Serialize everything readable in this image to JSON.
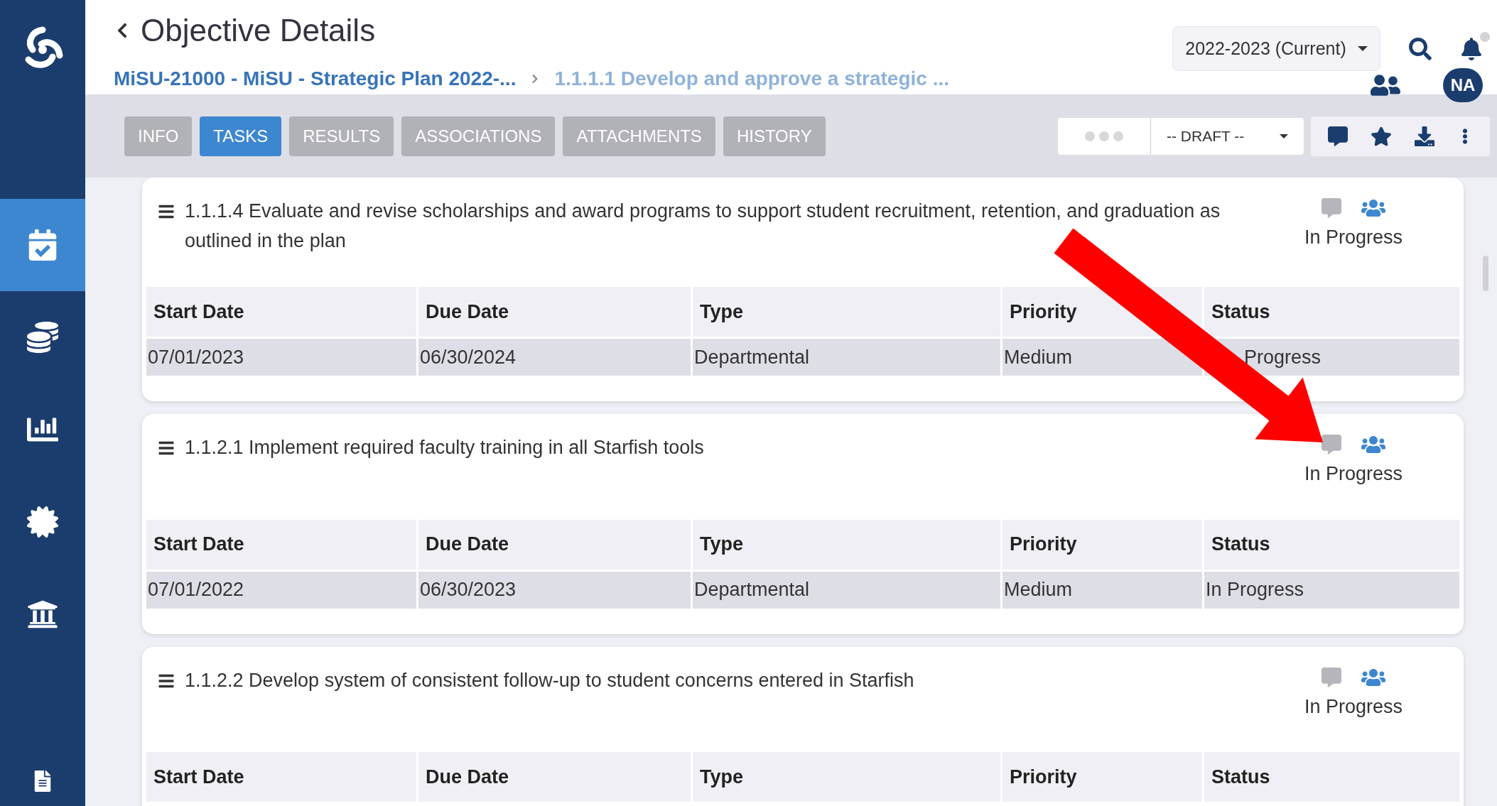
{
  "header": {
    "title": "Objective Details",
    "breadcrumbs": [
      "MiSU-21000 - MiSU - Strategic Plan 2022-...",
      "1.1.1.1 Develop and approve a strategic ..."
    ],
    "year": "2022-2023 (Current)",
    "avatar": "NA"
  },
  "sidebar": {
    "items": [
      {
        "kind": "calendar",
        "selected": true
      },
      {
        "kind": "coins",
        "selected": false
      },
      {
        "kind": "chart",
        "selected": false
      },
      {
        "kind": "badge",
        "selected": false
      },
      {
        "kind": "institution",
        "selected": false
      },
      {
        "kind": "file",
        "selected": false
      }
    ]
  },
  "tabs": [
    {
      "label": "INFO",
      "selected": false
    },
    {
      "label": "TASKS",
      "selected": true
    },
    {
      "label": "RESULTS",
      "selected": false
    },
    {
      "label": "ASSOCIATIONS",
      "selected": false
    },
    {
      "label": "ATTACHMENTS",
      "selected": false
    },
    {
      "label": "HISTORY",
      "selected": false
    }
  ],
  "stage_select": "-- DRAFT --",
  "tasks": [
    {
      "title": "1.1.1.4 Evaluate and revise scholarships and award programs to support student recruitment, retention, and graduation as outlined in the plan",
      "status": "In Progress",
      "columns": [
        "Start Date",
        "Due Date",
        "Type",
        "Priority",
        "Status"
      ],
      "row": [
        "07/01/2023",
        "06/30/2024",
        "Departmental",
        "Medium",
        "Progress"
      ]
    },
    {
      "title": "1.1.2.1 Implement required faculty training in all Starfish tools",
      "status": "In Progress",
      "columns": [
        "Start Date",
        "Due Date",
        "Type",
        "Priority",
        "Status"
      ],
      "row": [
        "07/01/2022",
        "06/30/2023",
        "Departmental",
        "Medium",
        "In Progress"
      ]
    },
    {
      "title": "1.1.2.2 Develop system of consistent follow-up to student concerns entered in Starfish",
      "status": "In Progress",
      "columns": [
        "Start Date",
        "Due Date",
        "Type",
        "Priority",
        "Status"
      ]
    }
  ]
}
